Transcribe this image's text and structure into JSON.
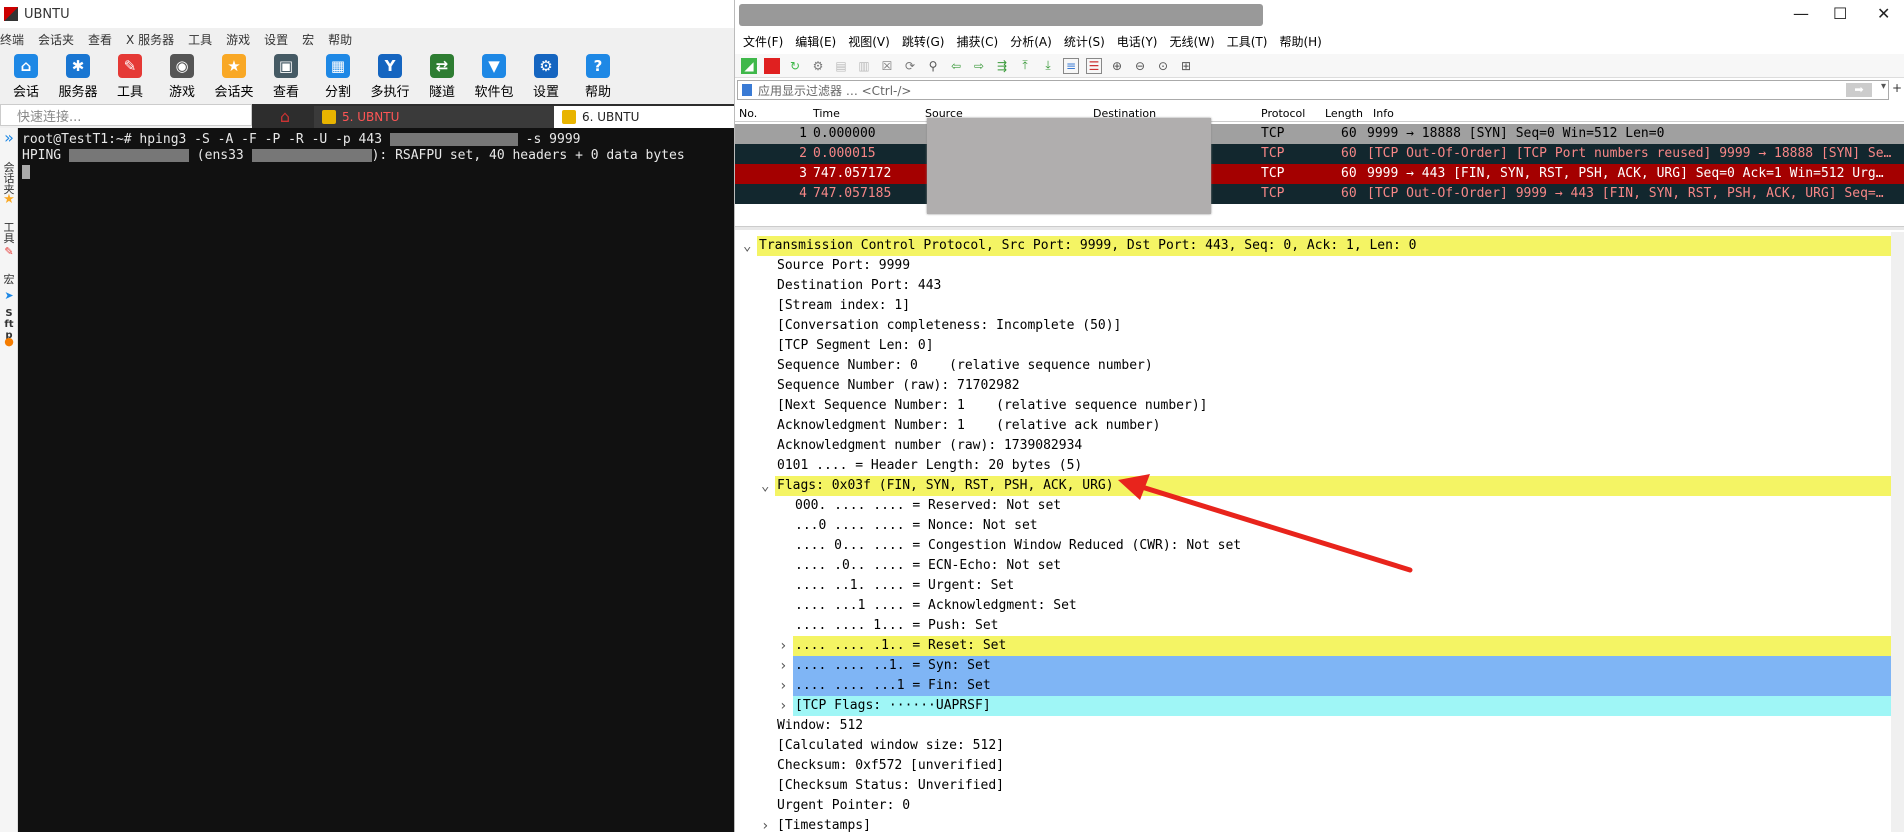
{
  "xshell": {
    "title": "UBNTU",
    "menu": [
      "终端",
      "会话夹",
      "查看",
      "X 服务器",
      "工具",
      "游戏",
      "设置",
      "宏",
      "帮助"
    ],
    "toolbar": [
      {
        "label": "会话",
        "icon": "session-icon",
        "color": "#1e88e5"
      },
      {
        "label": "服务器",
        "icon": "server-icon",
        "color": "#1976d2"
      },
      {
        "label": "工具",
        "icon": "tools-icon",
        "color": "#e53935"
      },
      {
        "label": "游戏",
        "icon": "gamepad-icon",
        "color": "#555555"
      },
      {
        "label": "会话夹",
        "icon": "star-icon",
        "color": "#f9a825"
      },
      {
        "label": "查看",
        "icon": "view-icon",
        "color": "#455a64"
      },
      {
        "label": "分割",
        "icon": "split-icon",
        "color": "#1e88e5"
      },
      {
        "label": "多执行",
        "icon": "multi-exec-icon",
        "color": "#1565c0"
      },
      {
        "label": "隧道",
        "icon": "tunnel-icon",
        "color": "#2e7d32"
      },
      {
        "label": "软件包",
        "icon": "package-icon",
        "color": "#1e88e5"
      },
      {
        "label": "设置",
        "icon": "settings-icon",
        "color": "#1565c0"
      },
      {
        "label": "帮助",
        "icon": "help-icon",
        "color": "#1e88e5"
      }
    ],
    "quick_connect_placeholder": "快速连接...",
    "tabs": [
      {
        "label": "5. UBNTU",
        "active": false
      },
      {
        "label": "6. UBNTU",
        "active": true
      }
    ],
    "sidebar": [
      "会话夹",
      "工具",
      "宏",
      "Sftp"
    ],
    "terminal": {
      "line1_prefix": "root@TestT1:~# hping3 -S -A -F -P -R -U -p 443 ",
      "line1_suffix": " -s 9999",
      "line2_prefix": "HPING ",
      "line2_mid": " (ens33 ",
      "line2_suffix": "): RSAFPU set, 40 headers + 0 data bytes"
    }
  },
  "wireshark": {
    "menu": [
      "文件(F)",
      "编辑(E)",
      "视图(V)",
      "跳转(G)",
      "捕获(C)",
      "分析(A)",
      "统计(S)",
      "电话(Y)",
      "无线(W)",
      "工具(T)",
      "帮助(H)"
    ],
    "filter_placeholder": "应用显示过滤器 … <Ctrl-/>",
    "columns": [
      "No.",
      "Time",
      "Source",
      "Destination",
      "Protocol",
      "Length",
      "Info"
    ],
    "packets": [
      {
        "no": "1",
        "time": "0.000000",
        "protocol": "TCP",
        "length": "60",
        "info": "9999 → 18888 [SYN] Seq=0 Win=512 Len=0",
        "bg": "#a0a0a0",
        "fg": "#000000"
      },
      {
        "no": "2",
        "time": "0.000015",
        "protocol": "TCP",
        "length": "60",
        "info": "[TCP Out-Of-Order] [TCP Port numbers reused] 9999 → 18888 [SYN] Se…",
        "bg": "#12272e",
        "fg": "#f78787"
      },
      {
        "no": "3",
        "time": "747.057172",
        "protocol": "TCP",
        "length": "60",
        "info": "9999 → 443 [FIN, SYN, RST, PSH, ACK, URG] Seq=0 Ack=1 Win=512 Urg…",
        "bg": "#a40000",
        "fg": "#ffffff"
      },
      {
        "no": "4",
        "time": "747.057185",
        "protocol": "TCP",
        "length": "60",
        "info": "[TCP Out-Of-Order] 9999 → 443 [FIN, SYN, RST, PSH, ACK, URG] Seq=…",
        "bg": "#12272e",
        "fg": "#f78787"
      }
    ],
    "details": [
      {
        "text": "Transmission Control Protocol, Src Port: 9999, Dst Port: 443, Seq: 0, Ack: 1, Len: 0",
        "indent": 0,
        "bg": "#f4f464",
        "expander": "open"
      },
      {
        "text": "Source Port: 9999",
        "indent": 1
      },
      {
        "text": "Destination Port: 443",
        "indent": 1
      },
      {
        "text": "[Stream index: 1]",
        "indent": 1
      },
      {
        "text": "[Conversation completeness: Incomplete (50)]",
        "indent": 1
      },
      {
        "text": "[TCP Segment Len: 0]",
        "indent": 1
      },
      {
        "text": "Sequence Number: 0    (relative sequence number)",
        "indent": 1
      },
      {
        "text": "Sequence Number (raw): 71702982",
        "indent": 1
      },
      {
        "text": "[Next Sequence Number: 1    (relative sequence number)]",
        "indent": 1
      },
      {
        "text": "Acknowledgment Number: 1    (relative ack number)",
        "indent": 1
      },
      {
        "text": "Acknowledgment number (raw): 1739082934",
        "indent": 1
      },
      {
        "text": "0101 .... = Header Length: 20 bytes (5)",
        "indent": 1
      },
      {
        "text": "Flags: 0x03f (FIN, SYN, RST, PSH, ACK, URG)",
        "indent": 1,
        "bg": "#f4f464",
        "expander": "open"
      },
      {
        "text": "000. .... .... = Reserved: Not set",
        "indent": 2
      },
      {
        "text": "...0 .... .... = Nonce: Not set",
        "indent": 2
      },
      {
        "text": ".... 0... .... = Congestion Window Reduced (CWR): Not set",
        "indent": 2
      },
      {
        "text": ".... .0.. .... = ECN-Echo: Not set",
        "indent": 2
      },
      {
        "text": ".... ..1. .... = Urgent: Set",
        "indent": 2
      },
      {
        "text": ".... ...1 .... = Acknowledgment: Set",
        "indent": 2
      },
      {
        "text": ".... .... 1... = Push: Set",
        "indent": 2
      },
      {
        "text": ".... .... .1.. = Reset: Set",
        "indent": 2,
        "bg": "#f4f464",
        "expander": "closed"
      },
      {
        "text": ".... .... ..1. = Syn: Set",
        "indent": 2,
        "bg": "#7fb5f5",
        "expander": "closed"
      },
      {
        "text": ".... .... ...1 = Fin: Set",
        "indent": 2,
        "bg": "#7fb5f5",
        "expander": "closed"
      },
      {
        "text": "[TCP Flags: ······UAPRSF]",
        "indent": 2,
        "bg": "#9ff6f6",
        "expander": "closed"
      },
      {
        "text": "Window: 512",
        "indent": 1
      },
      {
        "text": "[Calculated window size: 512]",
        "indent": 1
      },
      {
        "text": "Checksum: 0xf572 [unverified]",
        "indent": 1
      },
      {
        "text": "[Checksum Status: Unverified]",
        "indent": 1
      },
      {
        "text": "Urgent Pointer: 0",
        "indent": 1
      },
      {
        "text": "[Timestamps]",
        "indent": 1,
        "expander": "closed"
      }
    ],
    "annotation_color": "#e8241c"
  }
}
